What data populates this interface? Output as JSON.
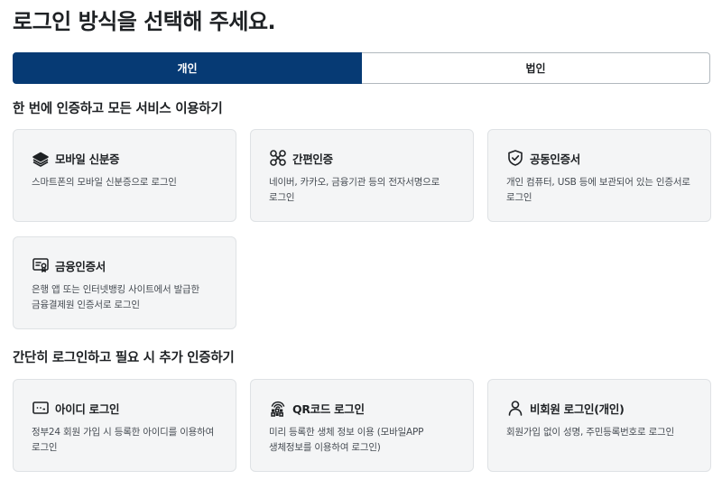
{
  "page_title": "로그인 방식을 선택해 주세요.",
  "tabs": [
    {
      "label": "개인",
      "active": true
    },
    {
      "label": "법인",
      "active": false
    }
  ],
  "sections": [
    {
      "title": "한 번에 인증하고 모든 서비스 이용하기",
      "cards": [
        {
          "icon": "mobile-id-icon",
          "title": "모바일 신분증",
          "desc": "스마트폰의 모바일 신분증으로 로그인"
        },
        {
          "icon": "simple-auth-icon",
          "title": "간편인증",
          "desc": "네이버, 카카오, 금융기관 등의 전자서명으로 로그인"
        },
        {
          "icon": "shield-check-icon",
          "title": "공동인증서",
          "desc": "개인 컴퓨터, USB 등에 보관되어 있는 인증서로 로그인"
        },
        {
          "icon": "certificate-icon",
          "title": "금융인증서",
          "desc": "은행 앱 또는 인터넷뱅킹 사이트에서 발급한 금융결제원 인증서로 로그인"
        }
      ]
    },
    {
      "title": "간단히 로그인하고 필요 시 추가 인증하기",
      "cards": [
        {
          "icon": "id-password-icon",
          "title": "아이디 로그인",
          "desc": "정부24 회원 가입 시 등록한 아이디를 이용하여 로그인"
        },
        {
          "icon": "qr-face-icon",
          "title": "QR코드 로그인",
          "desc": "미리 등록한 생체 정보 이용 (모바일APP 생체정보를 이용하여 로그인)"
        },
        {
          "icon": "user-icon",
          "title": "비회원 로그인(개인)",
          "desc": "회원가입 없이 성명, 주민등록번호로 로그인"
        }
      ]
    }
  ],
  "colors": {
    "primary": "#063a74",
    "card_bg": "#f4f5f6",
    "card_border": "#dfe2e5",
    "text": "#1e2124",
    "desc_text": "#464c53"
  }
}
